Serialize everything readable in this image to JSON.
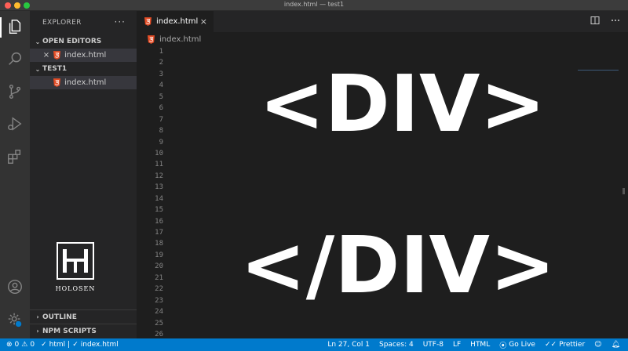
{
  "window": {
    "title": "index.html — test1"
  },
  "activity_bar": {
    "icons": [
      "explorer-icon",
      "search-icon",
      "source-control-icon",
      "run-debug-icon",
      "extensions-icon",
      "account-icon",
      "settings-gear-icon"
    ]
  },
  "sidebar": {
    "title": "EXPLORER",
    "more": "···",
    "open_editors": {
      "label": "OPEN EDITORS",
      "files": [
        {
          "name": "index.html"
        }
      ]
    },
    "folder": {
      "label": "TEST1",
      "files": [
        {
          "name": "index.html"
        }
      ]
    },
    "outline_label": "OUTLINE",
    "npm_label": "NPM SCRIPTS",
    "logo_text": "HOLOSEN"
  },
  "editor": {
    "tab_label": "index.html",
    "tab_close": "×",
    "breadcrumb": "index.html",
    "line_numbers": [
      "1",
      "2",
      "3",
      "4",
      "5",
      "6",
      "7",
      "8",
      "9",
      "10",
      "11",
      "12",
      "13",
      "14",
      "15",
      "16",
      "17",
      "18",
      "19",
      "20",
      "21",
      "22",
      "23",
      "24",
      "25",
      "26"
    ],
    "overlay_open": "<DIV>",
    "overlay_close": "</DIV>"
  },
  "statusbar": {
    "errors": "0",
    "warnings": "0",
    "check_html": "html",
    "separator": "|",
    "check_file": "index.html",
    "position": "Ln 27, Col 1",
    "spaces": "Spaces: 4",
    "encoding": "UTF-8",
    "eol": "LF",
    "language": "HTML",
    "go_live": "Go Live",
    "prettier": "Prettier"
  },
  "colors": {
    "accent": "#007acc",
    "html_icon": "#e44d26"
  }
}
